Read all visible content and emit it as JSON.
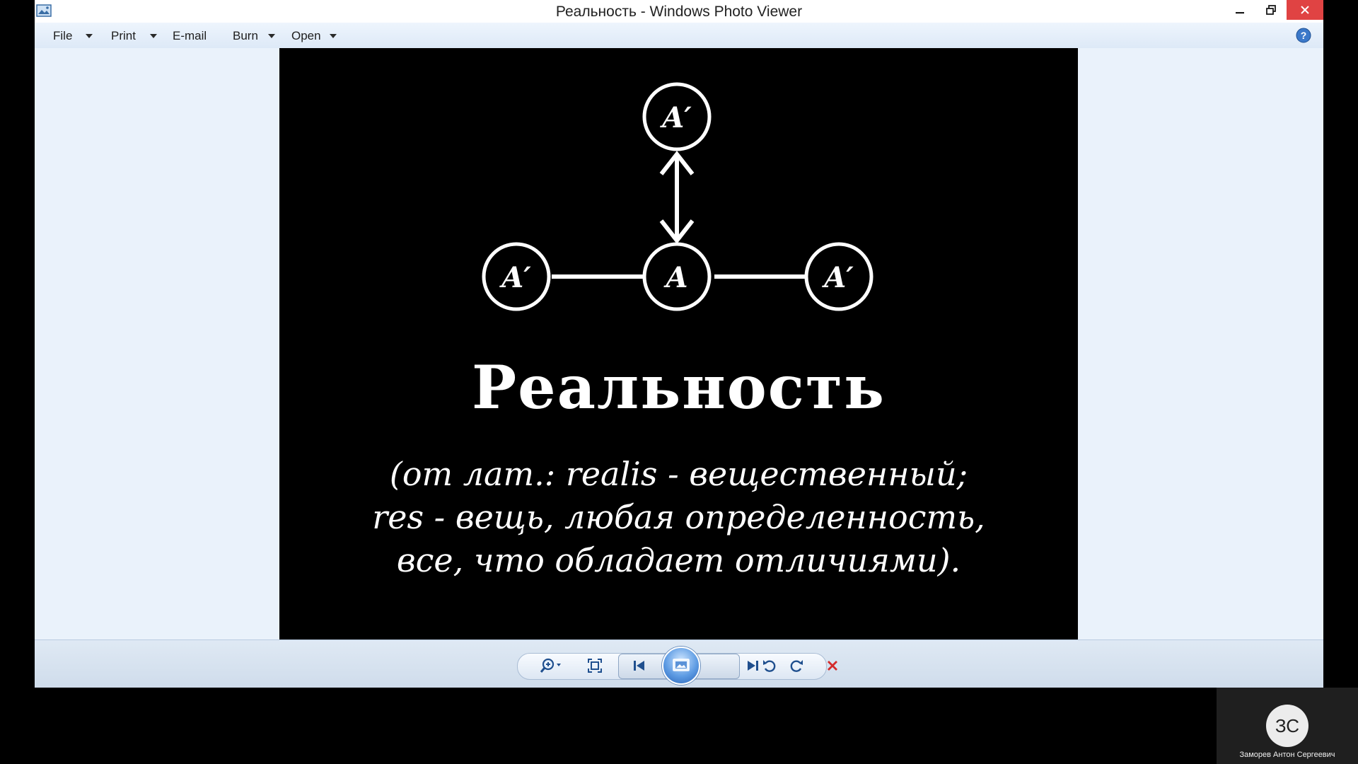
{
  "window": {
    "title": "Реальность - Windows Photo Viewer"
  },
  "menu": {
    "items": [
      {
        "label": "File",
        "has_dropdown": true
      },
      {
        "label": "Print",
        "has_dropdown": true
      },
      {
        "label": "E-mail",
        "has_dropdown": false
      },
      {
        "label": "Burn",
        "has_dropdown": true
      },
      {
        "label": "Open",
        "has_dropdown": true
      }
    ],
    "help_icon": "help-icon"
  },
  "photo": {
    "diagram_nodes": [
      "A′",
      "A",
      "A′",
      "A′"
    ],
    "title": "Реальность",
    "lines": [
      "(от лат.: realis - вещественный;",
      "res - вещь, любая определенность,",
      "все, что обладает отличиями)."
    ]
  },
  "toolbar": {
    "icons": [
      "zoom-icon",
      "fit-to-window-icon",
      "previous-icon",
      "slideshow-icon",
      "next-icon",
      "rotate-counterclockwise-icon",
      "rotate-clockwise-icon",
      "delete-icon"
    ]
  },
  "participant": {
    "initials": "ЗС",
    "name": "Заморев Антон Сергеевич"
  },
  "colors": {
    "menubar": "#e6eff9",
    "content_bg": "#eaf2fb",
    "photo_bg": "#000000",
    "close_button": "#e04343",
    "slideshow_button": "#3f7fd1",
    "delete_x": "#d42a2a"
  }
}
